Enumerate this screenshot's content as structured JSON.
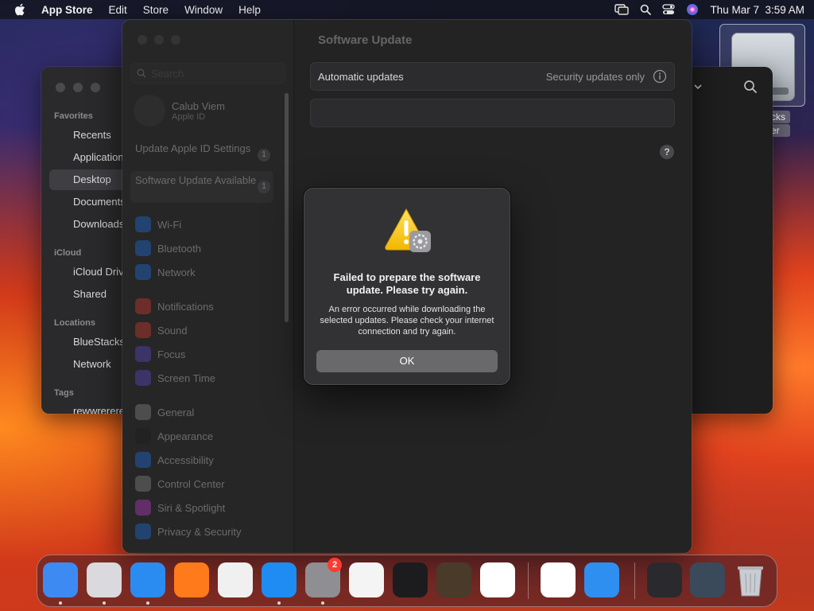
{
  "menubar": {
    "app_name": "App Store",
    "items": [
      "Edit",
      "Store",
      "Window",
      "Help"
    ],
    "clock": "Thu Mar 7  3:59 AM",
    "icons": [
      "apple-icon",
      "screen-mirroring-icon",
      "spotlight-search-icon",
      "control-center-icon",
      "siri-icon"
    ]
  },
  "desktop": {
    "drive_label_lines": [
      "cks",
      "er"
    ]
  },
  "finder": {
    "favorites_header": "Favorites",
    "favorites": [
      "Recents",
      "Applications",
      "Desktop",
      "Documents",
      "Downloads"
    ],
    "icloud_header": "iCloud",
    "icloud": [
      "iCloud Drive",
      "Shared"
    ],
    "locations_header": "Locations",
    "locations": [
      "BlueStacks",
      "Network"
    ],
    "tags_header": "Tags",
    "tags": [
      "rewwrerere"
    ]
  },
  "settings": {
    "search_placeholder": "Search",
    "account_name": "Calub Viem",
    "account_sub": "Apple ID",
    "notices": [
      {
        "label": "Update Apple ID Settings",
        "count": "1"
      },
      {
        "label": "Software Update Available",
        "count": "1"
      }
    ],
    "nav": [
      {
        "label": "Wi-Fi",
        "color": "#1e73e8",
        "icon": "wifi-icon"
      },
      {
        "label": "Bluetooth",
        "color": "#1e73e8",
        "icon": "bluetooth-icon"
      },
      {
        "label": "Network",
        "color": "#1e73e8",
        "icon": "globe-icon"
      },
      {
        "label": "Notifications",
        "color": "#e0392f",
        "icon": "bell-icon"
      },
      {
        "label": "Sound",
        "color": "#e0392f",
        "icon": "speaker-icon"
      },
      {
        "label": "Focus",
        "color": "#5b4bd6",
        "icon": "moon-icon"
      },
      {
        "label": "Screen Time",
        "color": "#5b4bd6",
        "icon": "hourglass-icon"
      },
      {
        "label": "General",
        "color": "#8e8e93",
        "icon": "gear-icon"
      },
      {
        "label": "Appearance",
        "color": "#1c1c1e",
        "icon": "appearance-icon"
      },
      {
        "label": "Accessibility",
        "color": "#1e73e8",
        "icon": "accessibility-icon"
      },
      {
        "label": "Control Center",
        "color": "#8e8e93",
        "icon": "control-center-icon"
      },
      {
        "label": "Siri & Spotlight",
        "color": "#c23bd1",
        "icon": "siri-icon"
      },
      {
        "label": "Privacy & Security",
        "color": "#1e73e8",
        "icon": "hand-icon"
      }
    ],
    "title": "Software Update",
    "auto_updates_label": "Automatic updates",
    "auto_updates_value": "Security updates only"
  },
  "alert": {
    "title": "Failed to prepare the software update. Please try again.",
    "message": "An error occurred while downloading the selected updates. Please check your internet connection and try again.",
    "ok_label": "OK",
    "icon": "warning-software-update-icon"
  },
  "dock": {
    "apps": [
      {
        "name": "Finder",
        "icon": "finder-icon",
        "color": "#3d8bf2",
        "running": true
      },
      {
        "name": "Launchpad",
        "icon": "launchpad-icon",
        "color": "#d9d9de",
        "running": true
      },
      {
        "name": "Safari",
        "icon": "safari-icon",
        "color": "#2a8cf0",
        "running": true
      },
      {
        "name": "Firefox",
        "icon": "firefox-icon",
        "color": "#ff7a1a",
        "running": false
      },
      {
        "name": "Chrome",
        "icon": "chrome-icon",
        "color": "#f0f0f0",
        "running": false
      },
      {
        "name": "App Store",
        "icon": "app-store-icon",
        "color": "#1e8cf2",
        "running": true
      },
      {
        "name": "System Settings",
        "icon": "system-settings-icon",
        "color": "#8e8e93",
        "running": true
      },
      {
        "name": "TextEdit",
        "icon": "textedit-icon",
        "color": "#f4f4f4",
        "running": false
      },
      {
        "name": "Terminal",
        "icon": "terminal-icon",
        "color": "#1c1c1e",
        "running": false
      },
      {
        "name": "GarageBand",
        "icon": "garageband-icon",
        "color": "#4a3a2a",
        "running": false
      },
      {
        "name": "Visual Studio Code",
        "icon": "vscode-icon",
        "color": "#ffffff",
        "running": false
      },
      {
        "name": "Visual Studio",
        "icon": "visual-studio-icon",
        "color": "#ffffff",
        "running": false
      },
      {
        "name": "Weather",
        "icon": "weather-icon",
        "color": "#2f8ff0",
        "running": false
      }
    ],
    "settings_badge": "2"
  }
}
